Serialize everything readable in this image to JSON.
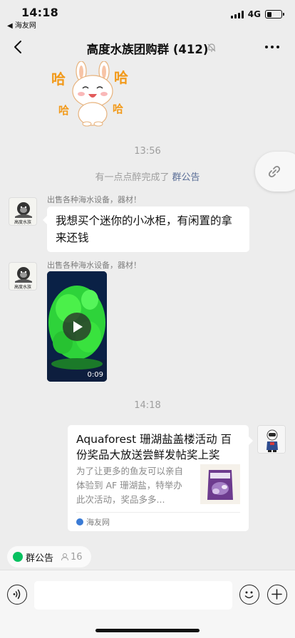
{
  "status_bar": {
    "time": "14:18",
    "back_app": "◀ 海友网",
    "network": "4G",
    "battery_level_percent": 35
  },
  "nav": {
    "title": "高度水族团购群 (412)",
    "back_icon": "chevron-left-icon",
    "mute_icon": "bell-muted-icon",
    "more_icon": "more-dots-icon"
  },
  "sticker": {
    "text_ha": "哈",
    "text_ha_small": "哈"
  },
  "timestamps": [
    "13:56",
    "14:18"
  ],
  "system_message": {
    "text": "有一点点醉完成了",
    "link": "群公告"
  },
  "messages": [
    {
      "sender": "出售各种海水设备，器材！",
      "avatar_label": "高度水族",
      "text": "我想买个迷你的小冰柜，有闲置的拿来还钱"
    },
    {
      "sender": "出售各种海水设备，器材！",
      "avatar_label": "高度水族",
      "video_duration": "0:09"
    }
  ],
  "card": {
    "title": "Aquaforest 珊湖盐盖楼活动 百份奖品大放送尝鲜发帖奖上奖",
    "description": "为了让更多的鱼友可以亲自体验到 AF 珊湖盐，特举办此次活动，奖品多多...",
    "source": "海友网"
  },
  "announcement": {
    "label": "群公告",
    "count": "16"
  },
  "input": {
    "placeholder": ""
  },
  "colors": {
    "background": "#ededed",
    "link": "#576b95",
    "green": "#07c160"
  }
}
